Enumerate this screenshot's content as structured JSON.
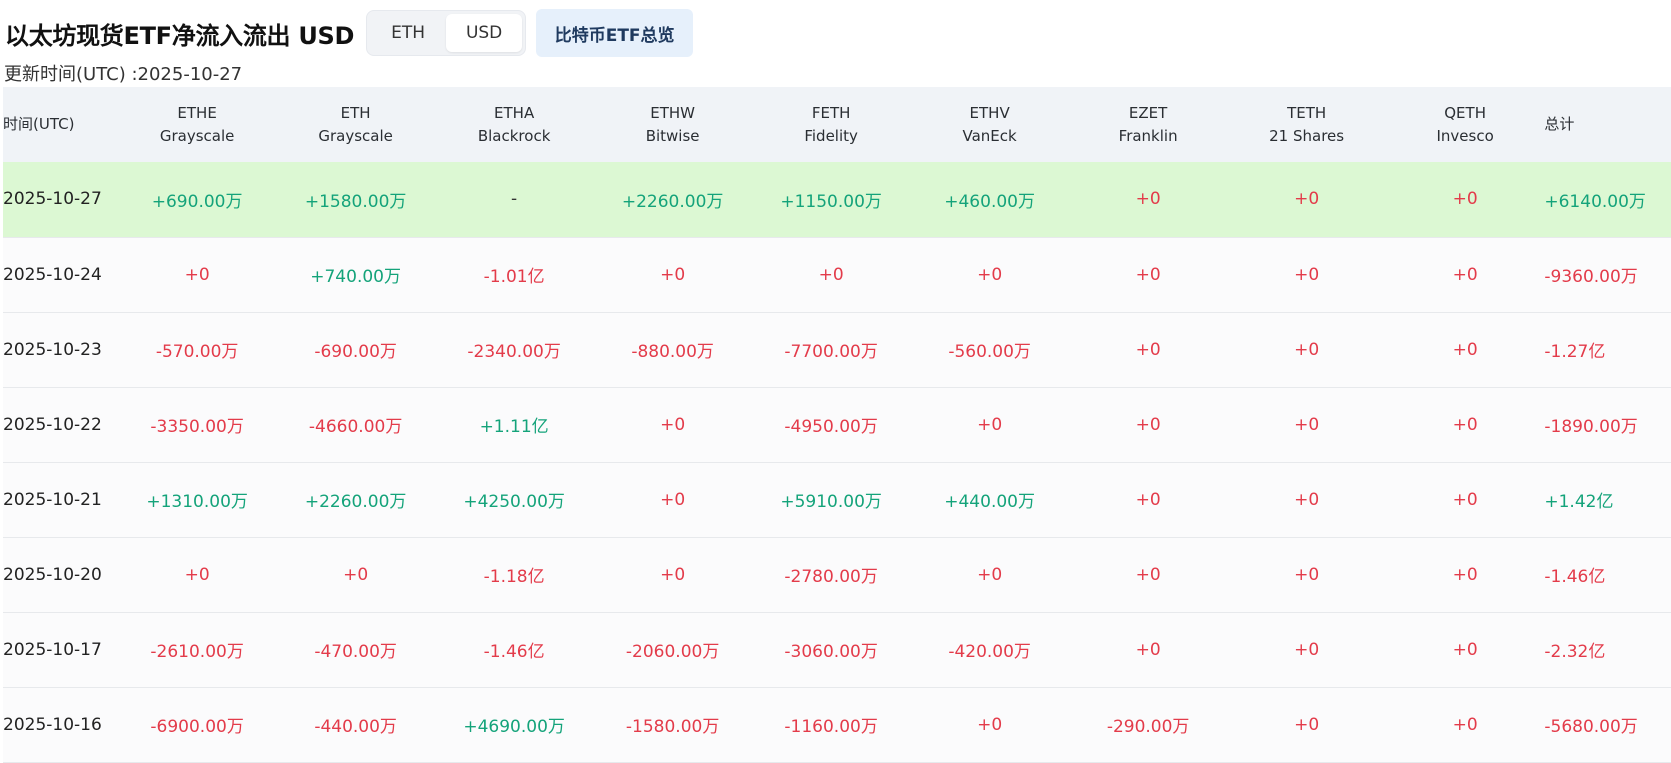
{
  "header": {
    "title": "以太坊现货ETF净流入流出 USD",
    "toggle": {
      "eth_label": "ETH",
      "usd_label": "USD",
      "active": "USD"
    },
    "btc_overview_label": "比特币ETF总览",
    "updated_label": "更新时间(UTC) :2025-10-27"
  },
  "colors": {
    "positive": "#14a37a",
    "negative": "#e33b4a",
    "highlight_row": "#dcf8d3",
    "header_bg": "#f0f3f7"
  },
  "table": {
    "columns": [
      {
        "code": "时间(UTC)",
        "issuer": ""
      },
      {
        "code": "ETHE",
        "issuer": "Grayscale"
      },
      {
        "code": "ETH",
        "issuer": "Grayscale"
      },
      {
        "code": "ETHA",
        "issuer": "Blackrock"
      },
      {
        "code": "ETHW",
        "issuer": "Bitwise"
      },
      {
        "code": "FETH",
        "issuer": "Fidelity"
      },
      {
        "code": "ETHV",
        "issuer": "VanEck"
      },
      {
        "code": "EZET",
        "issuer": "Franklin"
      },
      {
        "code": "TETH",
        "issuer": "21 Shares"
      },
      {
        "code": "QETH",
        "issuer": "Invesco"
      },
      {
        "code": "总计",
        "issuer": ""
      }
    ],
    "rows": [
      {
        "date": "2025-10-27",
        "cells": [
          "+690.00万",
          "+1580.00万",
          "-",
          "+2260.00万",
          "+1150.00万",
          "+460.00万",
          "+0",
          "+0",
          "+0"
        ],
        "total": "+6140.00万"
      },
      {
        "date": "2025-10-24",
        "cells": [
          "+0",
          "+740.00万",
          "-1.01亿",
          "+0",
          "+0",
          "+0",
          "+0",
          "+0",
          "+0"
        ],
        "total": "-9360.00万"
      },
      {
        "date": "2025-10-23",
        "cells": [
          "-570.00万",
          "-690.00万",
          "-2340.00万",
          "-880.00万",
          "-7700.00万",
          "-560.00万",
          "+0",
          "+0",
          "+0"
        ],
        "total": "-1.27亿"
      },
      {
        "date": "2025-10-22",
        "cells": [
          "-3350.00万",
          "-4660.00万",
          "+1.11亿",
          "+0",
          "-4950.00万",
          "+0",
          "+0",
          "+0",
          "+0"
        ],
        "total": "-1890.00万"
      },
      {
        "date": "2025-10-21",
        "cells": [
          "+1310.00万",
          "+2260.00万",
          "+4250.00万",
          "+0",
          "+5910.00万",
          "+440.00万",
          "+0",
          "+0",
          "+0"
        ],
        "total": "+1.42亿"
      },
      {
        "date": "2025-10-20",
        "cells": [
          "+0",
          "+0",
          "-1.18亿",
          "+0",
          "-2780.00万",
          "+0",
          "+0",
          "+0",
          "+0"
        ],
        "total": "-1.46亿"
      },
      {
        "date": "2025-10-17",
        "cells": [
          "-2610.00万",
          "-470.00万",
          "-1.46亿",
          "-2060.00万",
          "-3060.00万",
          "-420.00万",
          "+0",
          "+0",
          "+0"
        ],
        "total": "-2.32亿"
      },
      {
        "date": "2025-10-16",
        "cells": [
          "-6900.00万",
          "-440.00万",
          "+4690.00万",
          "-1580.00万",
          "-1160.00万",
          "+0",
          "-290.00万",
          "+0",
          "+0"
        ],
        "total": "-5680.00万"
      }
    ]
  }
}
